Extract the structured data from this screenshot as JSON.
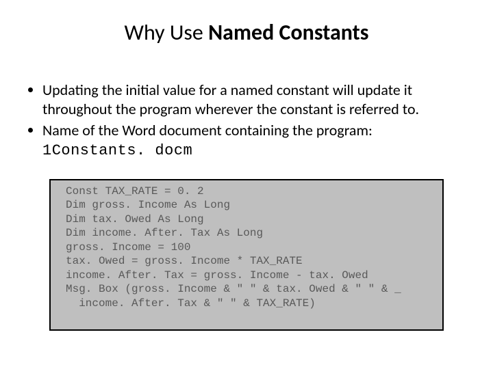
{
  "title": {
    "prefix": "Why Use ",
    "bold": "Named Constants"
  },
  "bullets": [
    "Updating the initial value for a named constant will update it throughout the program wherever the constant is referred to."
  ],
  "bullet2_prefix": "Name of the Word document containing the program: ",
  "bullet2_code": "1Constants. docm",
  "code": "Const TAX_RATE = 0. 2\nDim gross. Income As Long\nDim tax. Owed As Long\nDim income. After. Tax As Long\ngross. Income = 100\ntax. Owed = gross. Income * TAX_RATE\nincome. After. Tax = gross. Income - tax. Owed\nMsg. Box (gross. Income & \" \" & tax. Owed & \" \" & _\n  income. After. Tax & \" \" & TAX_RATE)"
}
